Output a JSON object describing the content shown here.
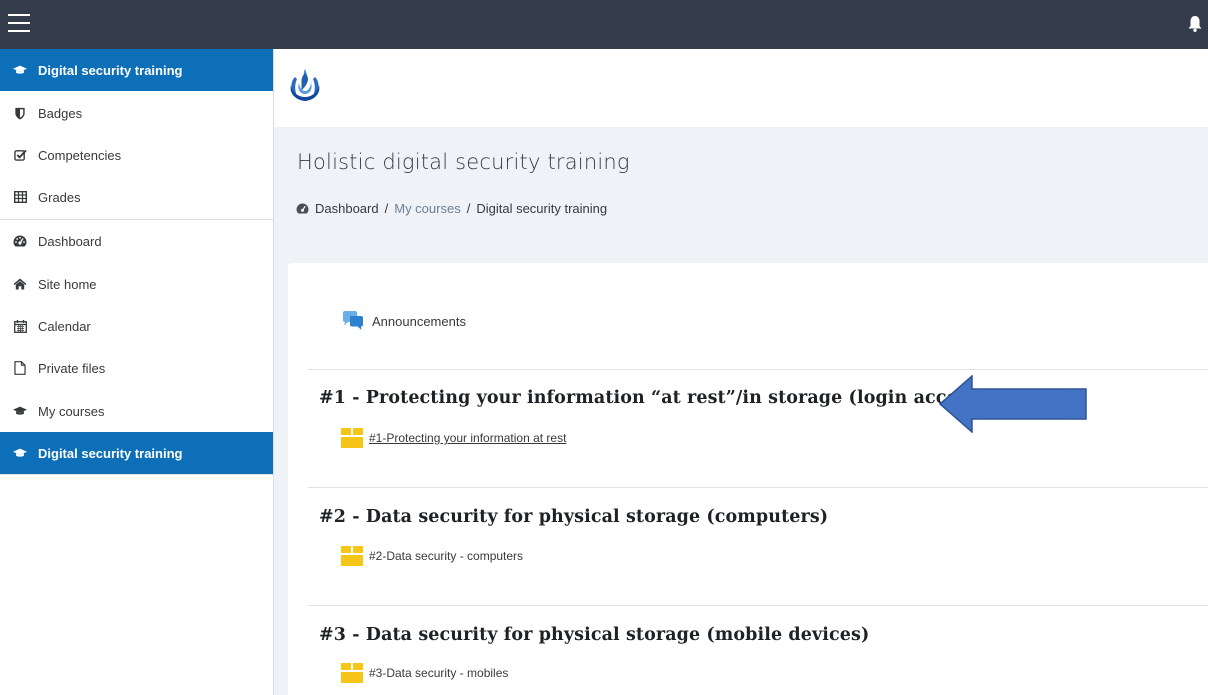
{
  "topbar": {
    "menu_icon": "hamburger-icon",
    "bell_icon": "bell-icon",
    "color": "#343b4b"
  },
  "sidebar": {
    "items": [
      {
        "label": "Digital security training",
        "icon": "graduation-cap-icon",
        "active": true
      },
      {
        "label": "Badges",
        "icon": "shield-icon"
      },
      {
        "label": "Competencies",
        "icon": "checkbox-icon"
      },
      {
        "label": "Grades",
        "icon": "table-icon"
      },
      {
        "label": "Dashboard",
        "icon": "dashboard-icon"
      },
      {
        "label": "Site home",
        "icon": "home-icon"
      },
      {
        "label": "Calendar",
        "icon": "calendar-icon"
      },
      {
        "label": "Private files",
        "icon": "file-icon"
      },
      {
        "label": "My courses",
        "icon": "graduation-cap-icon"
      },
      {
        "label": "Digital security training",
        "icon": "graduation-cap-icon",
        "active": true
      }
    ],
    "active_color": "#0d6fb8"
  },
  "header": {
    "title": "Holistic digital security training",
    "breadcrumb": [
      {
        "label": "Dashboard"
      },
      {
        "label": "My courses"
      },
      {
        "label": "Digital security training"
      }
    ],
    "separator": "/"
  },
  "main": {
    "announcements": "Announcements",
    "sections": [
      {
        "title": "#1 - Protecting your information “at rest”/in storage (login access)",
        "activity": "#1-Protecting your information at rest"
      },
      {
        "title": "#2 - Data security for physical storage (computers)",
        "activity": "#2-Data security - computers"
      },
      {
        "title": "#3 - Data security for physical storage (mobile devices)",
        "activity": "#3-Data security - mobiles"
      }
    ]
  },
  "annotation": {
    "arrow_color": "#4472c4"
  }
}
